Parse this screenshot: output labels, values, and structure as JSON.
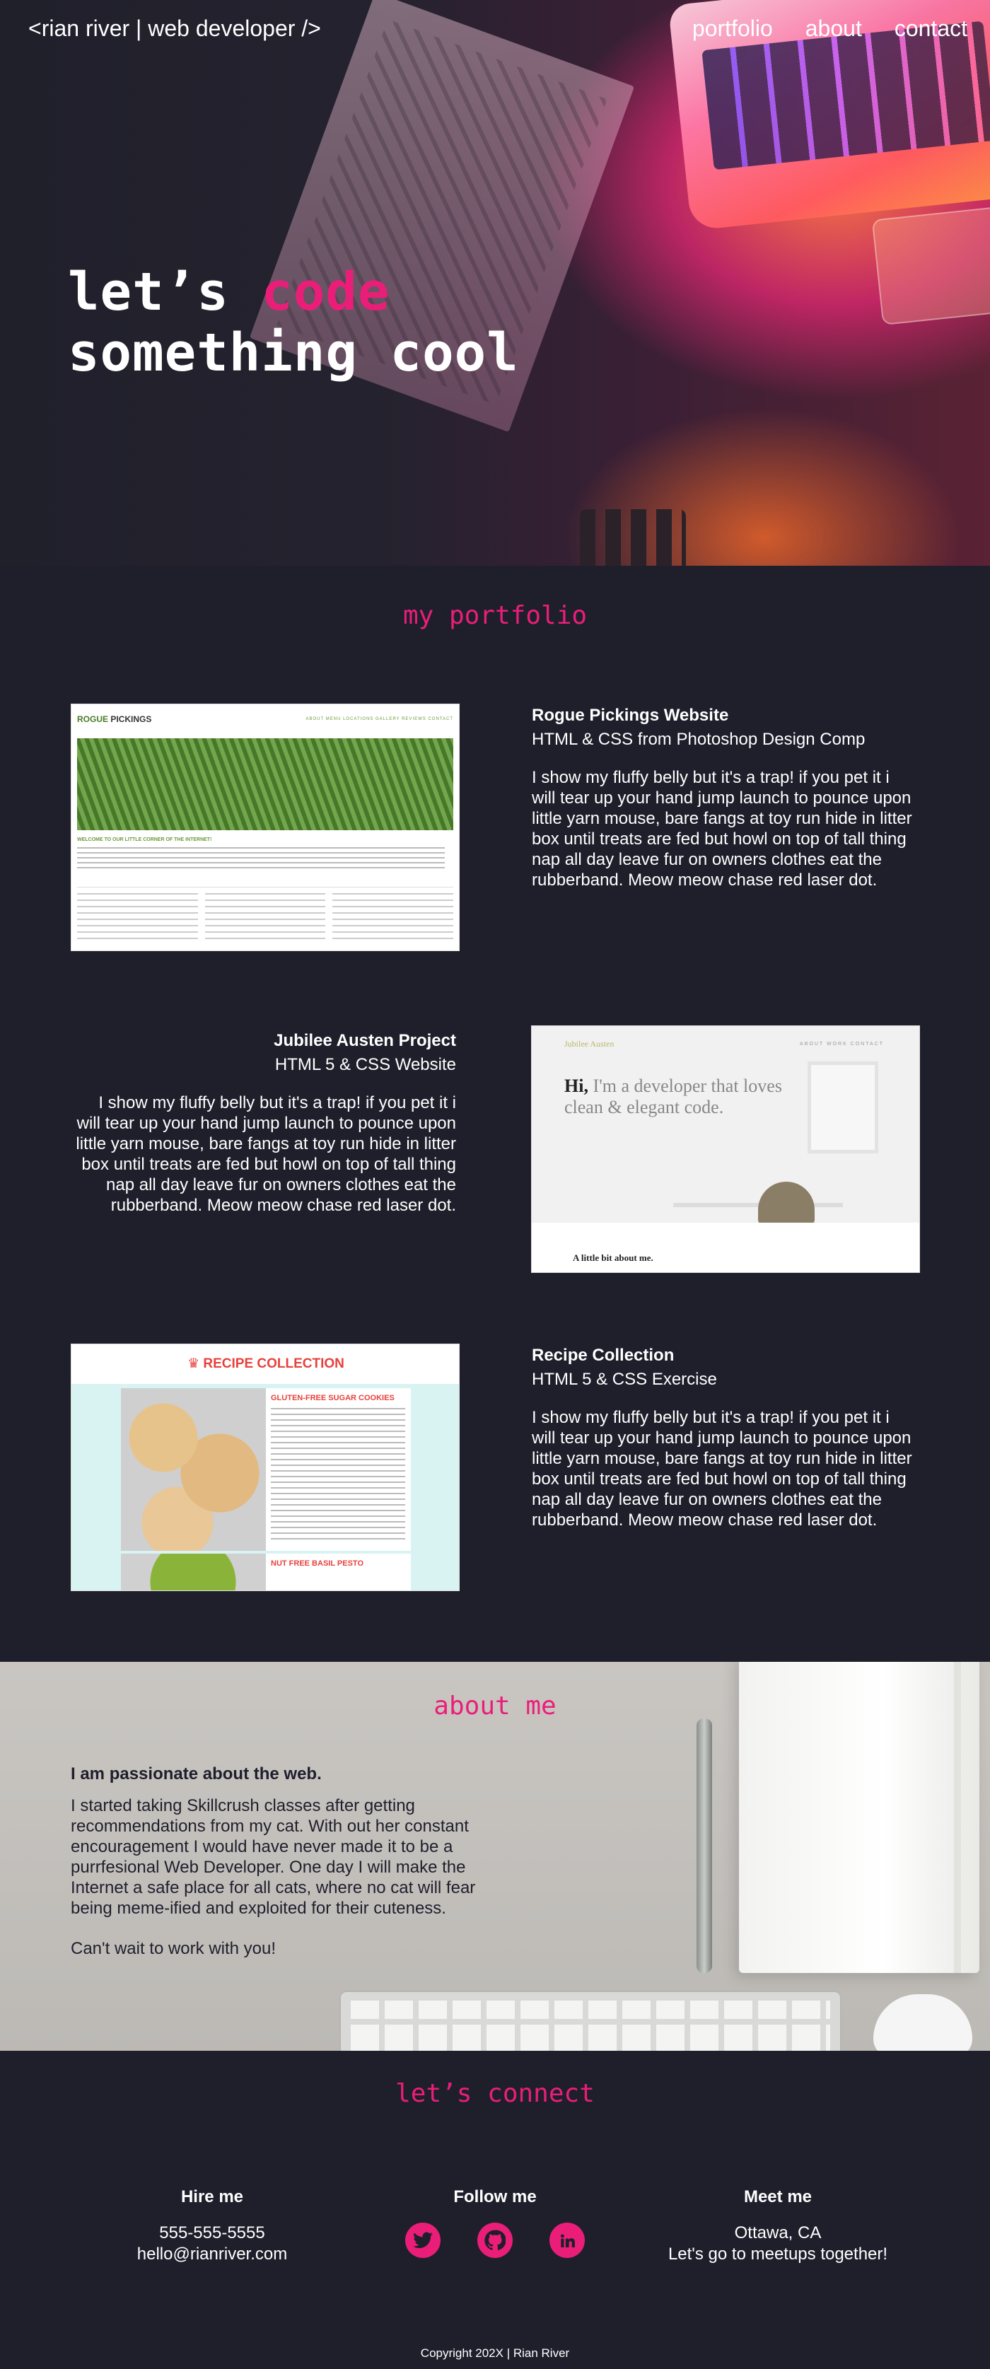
{
  "header": {
    "logo": "<rian river | web developer />",
    "nav": [
      "portfolio",
      "about",
      "contact"
    ]
  },
  "hero": {
    "line1_prefix": "let’s ",
    "line1_highlight": "code",
    "line2": "something cool"
  },
  "portfolio": {
    "title": "my portfolio",
    "projects": [
      {
        "name": "Rogue Pickings Website",
        "subtitle": "HTML & CSS from Photoshop Design Comp",
        "description": "I show my fluffy belly but it's a trap! if you pet it i will tear up your hand jump launch to pounce upon little yarn mouse, bare fangs at toy run hide in litter box until treats are fed but howl on top of tall thing nap all day leave fur on owners clothes eat the rubberband. Meow meow chase red laser dot.",
        "thumb": {
          "brand_a": "ROGUE",
          "brand_b": " PICKINGS",
          "menu": "ABOUT  MENU  LOCATIONS  GALLERY  REVIEWS  CONTACT",
          "welcome": "WELCOME TO OUR LITTLE CORNER OF THE INTERNET!"
        }
      },
      {
        "name": "Jubilee Austen Project",
        "subtitle": "HTML 5 & CSS Website",
        "description": "I show my fluffy belly but it's a trap! if you pet it i will tear up your hand jump launch to pounce upon little yarn mouse, bare fangs at toy run hide in litter box until treats are fed but howl on top of tall thing nap all day leave fur on owners clothes eat the rubberband. Meow meow chase red laser dot.",
        "thumb": {
          "brand": "Jubilee Austen",
          "menu": "ABOUT   WORK   CONTACT",
          "hi": "Hi,",
          "tagline": " I'm a developer that loves clean & elegant code.",
          "footer": "A little bit about me."
        }
      },
      {
        "name": "Recipe Collection",
        "subtitle": "HTML 5 & CSS Exercise",
        "description": "I show my fluffy belly but it's a trap! if you pet it i will tear up your hand jump launch to pounce upon little yarn mouse, bare fangs at toy run hide in litter box until treats are fed but howl on top of tall thing nap all day leave fur on owners clothes eat the rubberband. Meow meow chase red laser dot.",
        "thumb": {
          "title": "RECIPE COLLECTION",
          "recipe1": "GLUTEN-FREE SUGAR COOKIES",
          "recipe2": "NUT FREE BASIL PESTO"
        }
      }
    ]
  },
  "about": {
    "title": "about me",
    "heading": "I am passionate about the web.",
    "body": "I started taking Skillcrush classes after getting recommendations from my cat. With out her constant encouragement I would have never made it to be a purrfesional Web Developer. One day I will make the Internet a safe place for all cats, where no cat will fear being meme-ified and exploited for their cuteness.",
    "closing": "Can't wait to work with you!"
  },
  "connect": {
    "title": "let’s connect",
    "hire": {
      "heading": "Hire me",
      "phone": "555-555-5555",
      "email": "hello@rianriver.com"
    },
    "follow": {
      "heading": "Follow me",
      "icons": [
        "twitter-icon",
        "github-icon",
        "linkedin-icon"
      ]
    },
    "meet": {
      "heading": "Meet me",
      "location": "Ottawa, CA",
      "note": "Let's go to meetups together!"
    }
  },
  "footer": {
    "copyright": "Copyright 202X  |  Rian River"
  },
  "colors": {
    "accent": "#ea1e79",
    "background": "#1f1f2c",
    "text": "#ffffff"
  }
}
